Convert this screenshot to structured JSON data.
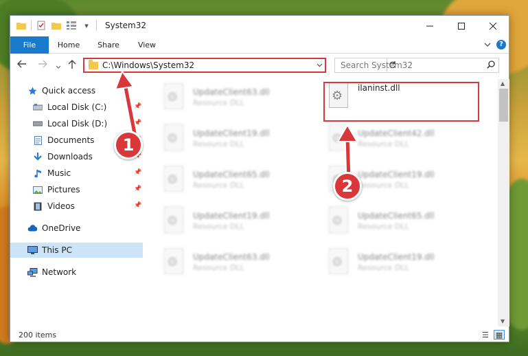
{
  "window": {
    "title": "System32",
    "qat_dropdown": "▾"
  },
  "ribbon": {
    "tabs": [
      "File",
      "Home",
      "Share",
      "View"
    ],
    "help_label": "?"
  },
  "address_bar": {
    "path": "C:\\Windows\\System32"
  },
  "search": {
    "placeholder": "Search System32"
  },
  "nav_pane": {
    "items": [
      {
        "label": "Quick access",
        "icon": "star-icon",
        "pinned": false
      },
      {
        "label": "Local Disk (C:)",
        "icon": "drive-icon",
        "pinned": true
      },
      {
        "label": "Local Disk (D:)",
        "icon": "drive-icon",
        "pinned": true
      },
      {
        "label": "Documents",
        "icon": "document-icon",
        "pinned": true
      },
      {
        "label": "Downloads",
        "icon": "download-icon",
        "pinned": true
      },
      {
        "label": "Music",
        "icon": "music-icon",
        "pinned": true
      },
      {
        "label": "Pictures",
        "icon": "picture-icon",
        "pinned": true
      },
      {
        "label": "Videos",
        "icon": "video-icon",
        "pinned": true
      },
      {
        "label": "OneDrive",
        "icon": "cloud-icon",
        "pinned": false
      },
      {
        "label": "This PC",
        "icon": "computer-icon",
        "pinned": false,
        "selected": true
      },
      {
        "label": "Network",
        "icon": "network-icon",
        "pinned": false
      }
    ]
  },
  "files": [
    {
      "name": "UpdateClient63.dll",
      "type": "Resource DLL",
      "blurred": true
    },
    {
      "name": "ilaninst.dll",
      "type": "",
      "blurred": false,
      "highlighted": true
    },
    {
      "name": "UpdateClient19.dll",
      "type": "Resource DLL",
      "blurred": true
    },
    {
      "name": "UpdateClient42.dll",
      "type": "Resource DLL",
      "blurred": true
    },
    {
      "name": "UpdateClient65.dll",
      "type": "Resource DLL",
      "blurred": true
    },
    {
      "name": "UpdateClient19.dll",
      "type": "Resource DLL",
      "blurred": true
    },
    {
      "name": "UpdateClient19.dll",
      "type": "Resource DLL",
      "blurred": true
    },
    {
      "name": "UpdateClient65.dll",
      "type": "Resource DLL",
      "blurred": true
    },
    {
      "name": "UpdateClient63.dll",
      "type": "Resource DLL",
      "blurred": true
    },
    {
      "name": "UpdateClient19.dll",
      "type": "Resource DLL",
      "blurred": true
    }
  ],
  "status": {
    "item_count": "200 items"
  },
  "callouts": {
    "step1": "1",
    "step2": "2",
    "color": "#d9383a"
  },
  "colors": {
    "accent": "#1979ca",
    "selection": "#cce4f7"
  }
}
